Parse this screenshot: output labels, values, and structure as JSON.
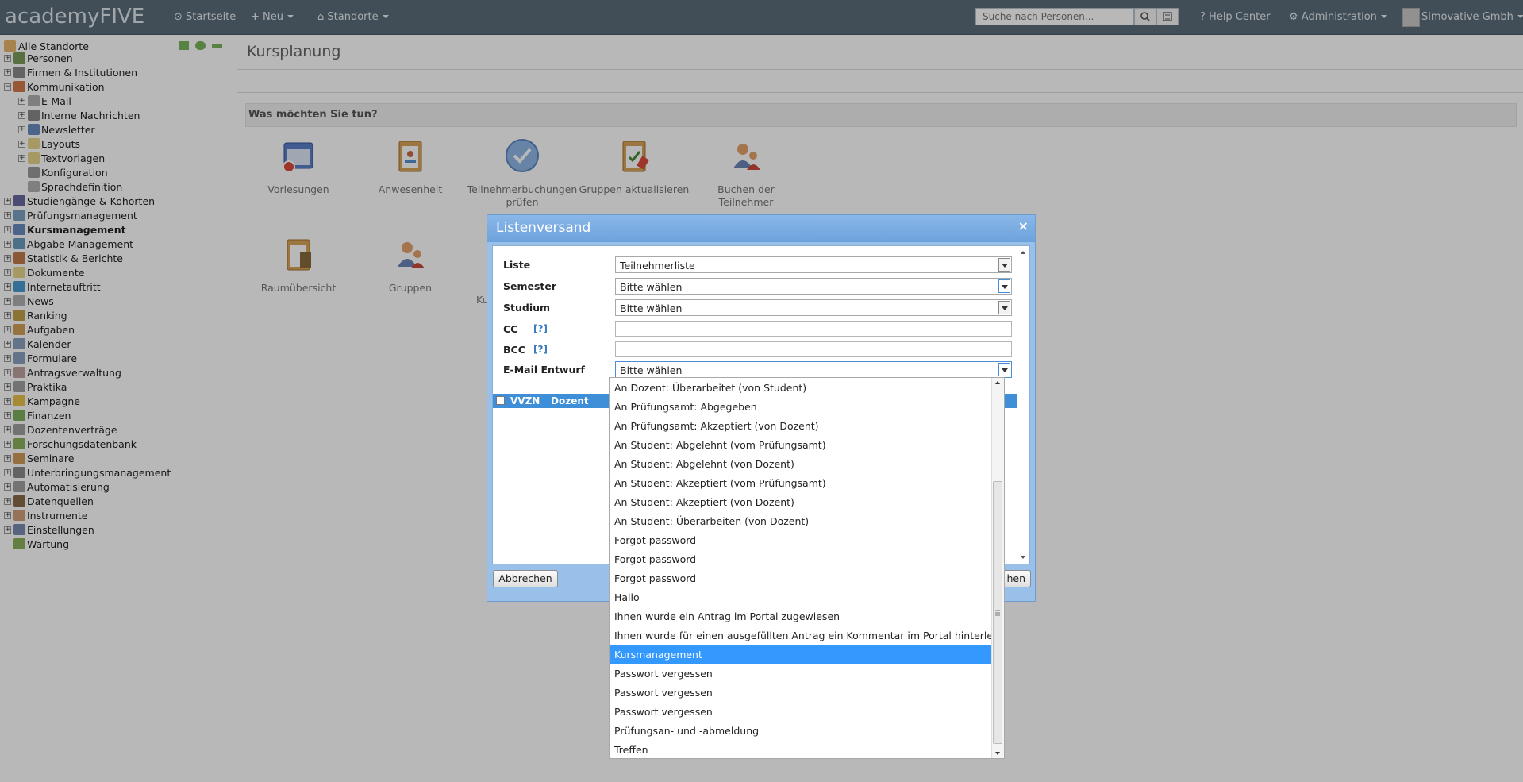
{
  "topbar": {
    "logo": "academyFIVE",
    "nav": {
      "home": "Startseite",
      "new": "Neu",
      "locations": "Standorte",
      "help": "Help Center",
      "admin": "Administration",
      "user": "Simovative Gmbh"
    },
    "search_placeholder": "Suche nach Personen..."
  },
  "sidebar": {
    "root": "Alle Standorte",
    "items": [
      {
        "label": "Personen",
        "icon": "persons-icon",
        "expanded": false,
        "level": 0
      },
      {
        "label": "Firmen & Institutionen",
        "icon": "building-icon",
        "expanded": false,
        "level": 0
      },
      {
        "label": "Kommunikation",
        "icon": "communication-icon",
        "expanded": true,
        "level": 0
      },
      {
        "label": "E-Mail",
        "icon": "email-icon",
        "expanded": false,
        "level": 1
      },
      {
        "label": "Interne Nachrichten",
        "icon": "messages-icon",
        "expanded": false,
        "level": 1
      },
      {
        "label": "Newsletter",
        "icon": "newsletter-icon",
        "expanded": false,
        "level": 1
      },
      {
        "label": "Layouts",
        "icon": "folder-icon",
        "expanded": false,
        "level": 1
      },
      {
        "label": "Textvorlagen",
        "icon": "folder-icon",
        "expanded": false,
        "level": 1
      },
      {
        "label": "Konfiguration",
        "icon": "tools-icon",
        "expanded": null,
        "level": 1
      },
      {
        "label": "Sprachdefinition",
        "icon": "language-icon",
        "expanded": null,
        "level": 1
      },
      {
        "label": "Studiengänge & Kohorten",
        "icon": "graduation-cap-icon",
        "expanded": false,
        "level": 0
      },
      {
        "label": "Prüfungsmanagement",
        "icon": "exam-icon",
        "expanded": false,
        "level": 0
      },
      {
        "label": "Kursmanagement",
        "icon": "course-icon",
        "expanded": false,
        "level": 0,
        "bold": true
      },
      {
        "label": "Abgabe Management",
        "icon": "submission-icon",
        "expanded": false,
        "level": 0
      },
      {
        "label": "Statistik & Berichte",
        "icon": "chart-icon",
        "expanded": false,
        "level": 0
      },
      {
        "label": "Dokumente",
        "icon": "folder-icon",
        "expanded": false,
        "level": 0
      },
      {
        "label": "Internetauftritt",
        "icon": "globe-icon",
        "expanded": false,
        "level": 0
      },
      {
        "label": "News",
        "icon": "news-icon",
        "expanded": false,
        "level": 0
      },
      {
        "label": "Ranking",
        "icon": "ranking-icon",
        "expanded": false,
        "level": 0
      },
      {
        "label": "Aufgaben",
        "icon": "tasks-icon",
        "expanded": false,
        "level": 0
      },
      {
        "label": "Kalender",
        "icon": "calendar-icon",
        "expanded": false,
        "level": 0
      },
      {
        "label": "Formulare",
        "icon": "forms-icon",
        "expanded": false,
        "level": 0
      },
      {
        "label": "Antragsverwaltung",
        "icon": "application-icon",
        "expanded": false,
        "level": 0
      },
      {
        "label": "Praktika",
        "icon": "internship-icon",
        "expanded": false,
        "level": 0
      },
      {
        "label": "Kampagne",
        "icon": "star-icon",
        "expanded": false,
        "level": 0
      },
      {
        "label": "Finanzen",
        "icon": "money-icon",
        "expanded": false,
        "level": 0
      },
      {
        "label": "Dozentenverträge",
        "icon": "contract-icon",
        "expanded": false,
        "level": 0
      },
      {
        "label": "Forschungsdatenbank",
        "icon": "research-icon",
        "expanded": false,
        "level": 0
      },
      {
        "label": "Seminare",
        "icon": "seminar-icon",
        "expanded": false,
        "level": 0
      },
      {
        "label": "Unterbringungsmanagement",
        "icon": "housing-icon",
        "expanded": false,
        "level": 0
      },
      {
        "label": "Automatisierung",
        "icon": "gear-icon",
        "expanded": false,
        "level": 0
      },
      {
        "label": "Datenquellen",
        "icon": "database-icon",
        "expanded": false,
        "level": 0
      },
      {
        "label": "Instrumente",
        "icon": "instrument-icon",
        "expanded": false,
        "level": 0
      },
      {
        "label": "Einstellungen",
        "icon": "settings-icon",
        "expanded": false,
        "level": 0
      },
      {
        "label": "Wartung",
        "icon": "maintenance-icon",
        "expanded": null,
        "level": 0
      }
    ]
  },
  "main": {
    "title": "Kursplanung",
    "section_title": "Was möchten Sie tun?",
    "tiles_row1": [
      {
        "label": "Vorlesungen",
        "icon": "lectures-icon"
      },
      {
        "label": "Anwesenheit",
        "icon": "attendance-icon"
      },
      {
        "label": "Teilnehmerbuchungen prüfen",
        "icon": "check-icon"
      },
      {
        "label": "Gruppen aktualisieren",
        "icon": "groups-update-icon"
      },
      {
        "label": "Buchen der Teilnehmer",
        "icon": "book-participants-icon"
      }
    ],
    "tiles_row2": [
      {
        "label": "Raumübersicht",
        "icon": "rooms-icon"
      },
      {
        "label": "Gruppen",
        "icon": "groups-icon"
      }
    ],
    "partial_text": "Ku"
  },
  "dialog": {
    "title": "Listenversand",
    "close": "×",
    "fields": {
      "liste": {
        "label": "Liste",
        "value": "Teilnehmerliste"
      },
      "semester": {
        "label": "Semester",
        "value": "Bitte wählen"
      },
      "studium": {
        "label": "Studium",
        "value": "Bitte wählen"
      },
      "cc": {
        "label": "CC",
        "help": "[?]",
        "value": ""
      },
      "bcc": {
        "label": "BCC",
        "help": "[?]",
        "value": ""
      },
      "email_draft": {
        "label": "E-Mail Entwurf",
        "value": "Bitte wählen"
      }
    },
    "grid_columns": [
      "VVZN",
      "Dozent"
    ],
    "cancel": "Abbrechen",
    "submit_partial": "hen"
  },
  "dropdown": {
    "selected_index": 14,
    "options": [
      "An Dozent: Überarbeitet (von Student)",
      "An Prüfungsamt: Abgegeben",
      "An Prüfungsamt: Akzeptiert (von Dozent)",
      "An Student: Abgelehnt (vom Prüfungsamt)",
      "An Student: Abgelehnt (von Dozent)",
      "An Student: Akzeptiert (vom Prüfungsamt)",
      "An Student: Akzeptiert (von Dozent)",
      "An Student: Überarbeiten (von Dozent)",
      "Forgot password",
      "Forgot password",
      "Forgot password",
      "Hallo",
      "Ihnen wurde ein Antrag im Portal zugewiesen",
      "Ihnen wurde für einen ausgefüllten Antrag ein Kommentar im Portal hinterlegt",
      "Kursmanagement",
      "Passwort vergessen",
      "Passwort vergessen",
      "Passwort vergessen",
      "Prüfungsan- und -abmeldung",
      "Treffen"
    ]
  },
  "colors": {
    "topbar": "#5b6d7b",
    "dialog_header": "#6ca2dc",
    "selection": "#3399ff",
    "grid_header": "#3f8ed8"
  }
}
